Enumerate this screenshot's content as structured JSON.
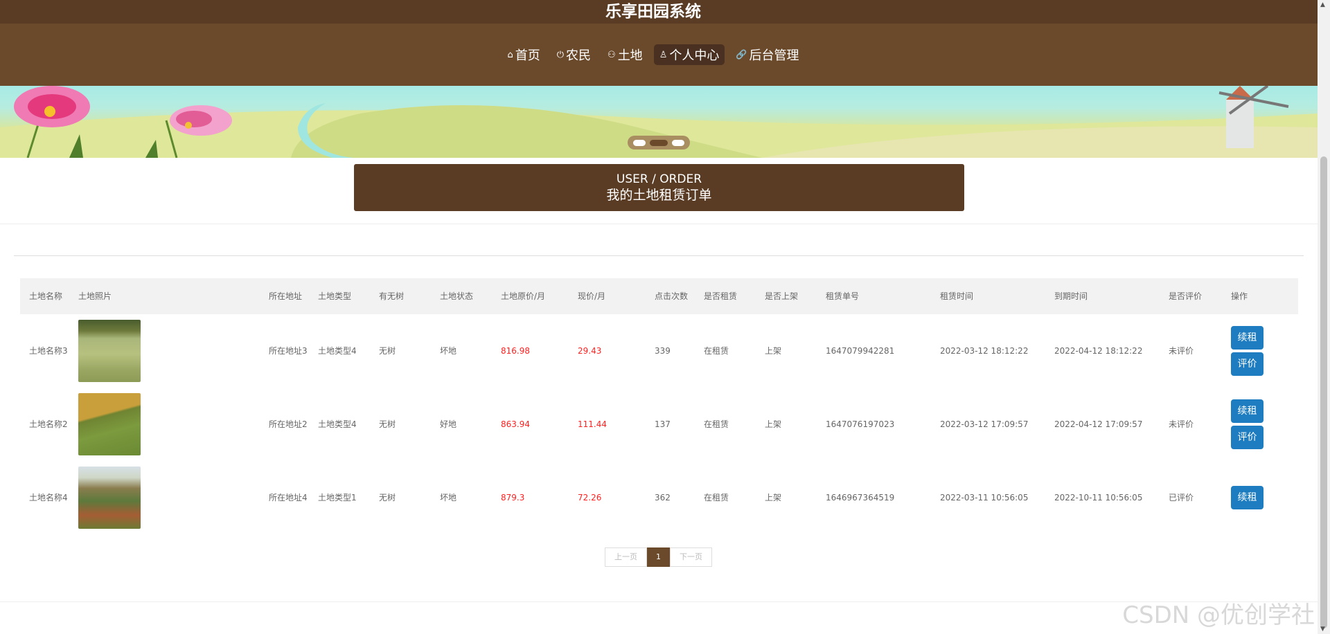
{
  "site": {
    "title": "乐享田园系统"
  },
  "nav": [
    {
      "icon": "⌂",
      "label": "首页"
    },
    {
      "icon": "⏻",
      "label": "农民"
    },
    {
      "icon": "⚇",
      "label": "土地"
    },
    {
      "icon": "♙",
      "label": "个人中心"
    },
    {
      "icon": "🔗",
      "label": "后台管理"
    }
  ],
  "section": {
    "en": "USER / ORDER",
    "cn": "我的土地租赁订单"
  },
  "table": {
    "headers": [
      "土地名称",
      "土地照片",
      "所在地址",
      "土地类型",
      "有无树",
      "土地状态",
      "土地原价/月",
      "现价/月",
      "点击次数",
      "是否租赁",
      "是否上架",
      "租赁单号",
      "租赁时间",
      "到期时间",
      "是否评价",
      "操作"
    ],
    "rows": [
      {
        "name": "土地名称3",
        "address": "所在地址3",
        "type": "土地类型4",
        "tree": "无树",
        "status": "坏地",
        "orig": "816.98",
        "price": "29.43",
        "clicks": "339",
        "rented": "在租赁",
        "listed": "上架",
        "order_no": "1647079942281",
        "start": "2022-03-12 18:12:22",
        "end": "2022-04-12 18:12:22",
        "reviewed": "未评价",
        "actions": [
          "续租",
          "评价"
        ]
      },
      {
        "name": "土地名称2",
        "address": "所在地址2",
        "type": "土地类型4",
        "tree": "无树",
        "status": "好地",
        "orig": "863.94",
        "price": "111.44",
        "clicks": "137",
        "rented": "在租赁",
        "listed": "上架",
        "order_no": "1647076197023",
        "start": "2022-03-12 17:09:57",
        "end": "2022-04-12 17:09:57",
        "reviewed": "未评价",
        "actions": [
          "续租",
          "评价"
        ]
      },
      {
        "name": "土地名称4",
        "address": "所在地址4",
        "type": "土地类型1",
        "tree": "无树",
        "status": "坏地",
        "orig": "879.3",
        "price": "72.26",
        "clicks": "362",
        "rented": "在租赁",
        "listed": "上架",
        "order_no": "1646967364519",
        "start": "2022-03-11 10:56:05",
        "end": "2022-10-11 10:56:05",
        "reviewed": "已评价",
        "actions": [
          "续租"
        ]
      }
    ]
  },
  "pagination": {
    "prev": "上一页",
    "current": "1",
    "next": "下一页"
  },
  "watermark": "CSDN @优创学社"
}
